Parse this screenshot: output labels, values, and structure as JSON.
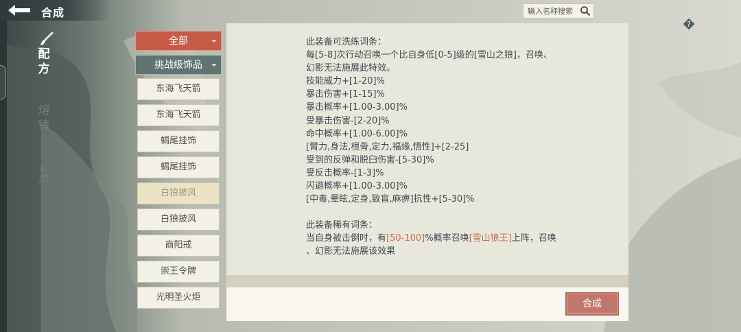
{
  "header": {
    "title": "合成"
  },
  "search": {
    "placeholder": "输入名称搜索"
  },
  "side_tabs": [
    "配方",
    "熔铸",
    "磨"
  ],
  "side_small_mark": "乐",
  "categories": {
    "all_label": "全部",
    "tier_label": "挑战级饰品"
  },
  "items": [
    "东海飞天箭",
    "东海飞天箭",
    "蝎尾挂饰",
    "蝎尾挂饰",
    "白狼披风",
    "白狼披风",
    "商阳戒",
    "崇王令牌",
    "光明圣火炬"
  ],
  "selected_item_index": 4,
  "description": {
    "refine_title": "此装备可洗练词条：",
    "refine_line1": "每[5-8]次行动召唤一个比自身低[0-5]级的[雪山之狼]，召唤、",
    "refine_line2": "幻影无法施展此特效。",
    "stats": [
      "技能威力+[1-20]%",
      "暴击伤害+[1-15]%",
      "暴击概率+[1.00-3.00]%",
      "受暴击伤害-[2-20]%",
      "命中概率+[1.00-6.00]%",
      "[臂力,身法,根骨,定力,福缘,悟性]+[2-25]",
      "受到的反弹和脱臼伤害-[5-30]%",
      "受反击概率-[1-3]%",
      "闪避概率+[1.00-3.00]%",
      "[中毒,晕眩,定身,致盲,麻痹]抗性+[5-30]%"
    ],
    "rare_title": "此装备稀有词条：",
    "rare_pre": "当自身被击倒时，有",
    "rare_chance": "[50-100]",
    "rare_mid": "%概率召唤",
    "rare_summon": "[雪山狼王]",
    "rare_post": "上阵，召唤",
    "rare_line2": "、幻影无法施展该效果"
  },
  "craft_button": "合成",
  "colors": {
    "accent_red": "#c85b47",
    "highlight": "#c76e55",
    "text": "#3f4a52"
  },
  "icons": [
    "back-arrow-icon",
    "search-icon",
    "help-icon",
    "brush-icon"
  ]
}
